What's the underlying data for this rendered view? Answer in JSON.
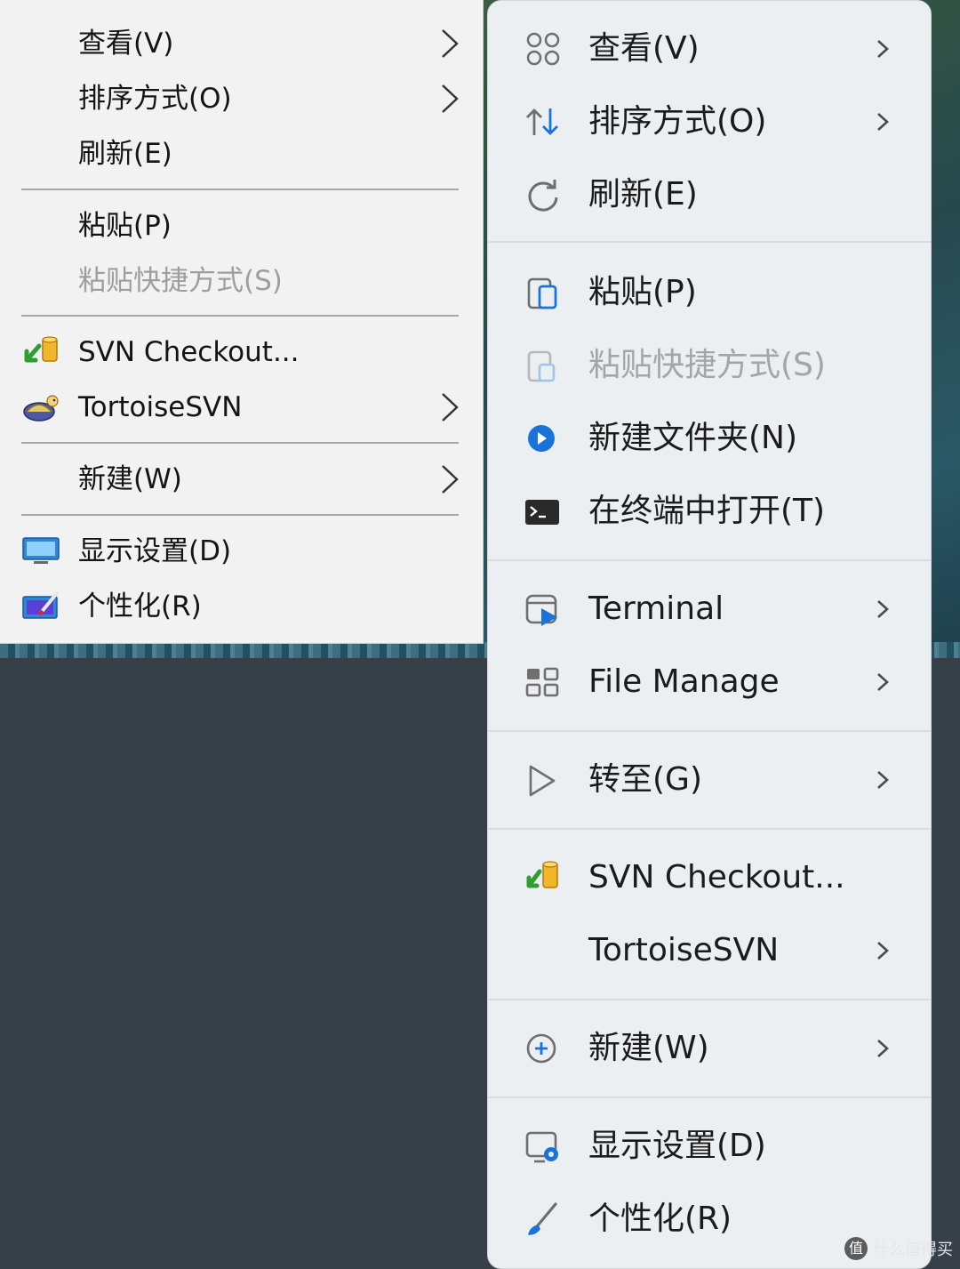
{
  "classic_menu": {
    "items": [
      {
        "label": "查看(V)",
        "icon": null,
        "submenu": true
      },
      {
        "label": "排序方式(O)",
        "icon": null,
        "submenu": true
      },
      {
        "label": "刷新(E)",
        "icon": null,
        "submenu": false
      },
      {
        "label": "粘贴(P)",
        "icon": null,
        "submenu": false
      },
      {
        "label": "粘贴快捷方式(S)",
        "icon": null,
        "submenu": false,
        "disabled": true
      },
      {
        "label": "SVN Checkout...",
        "icon": "svn-checkout-icon",
        "submenu": false
      },
      {
        "label": "TortoiseSVN",
        "icon": "tortoisesvn-icon",
        "submenu": true
      },
      {
        "label": "新建(W)",
        "icon": null,
        "submenu": true
      },
      {
        "label": "显示设置(D)",
        "icon": "monitor-icon",
        "submenu": false
      },
      {
        "label": "个性化(R)",
        "icon": "personalize-icon",
        "submenu": false
      }
    ]
  },
  "modern_menu": {
    "items": [
      {
        "label": "查看(V)",
        "icon": "view-grid-icon",
        "submenu": true
      },
      {
        "label": "排序方式(O)",
        "icon": "sort-arrows-icon",
        "submenu": true
      },
      {
        "label": "刷新(E)",
        "icon": "refresh-icon",
        "submenu": false
      },
      {
        "label": "粘贴(P)",
        "icon": "paste-icon",
        "submenu": false
      },
      {
        "label": "粘贴快捷方式(S)",
        "icon": "paste-shortcut-icon",
        "submenu": false,
        "disabled": true
      },
      {
        "label": "新建文件夹(N)",
        "icon": "new-folder-icon",
        "submenu": false
      },
      {
        "label": "在终端中打开(T)",
        "icon": "terminal-icon",
        "submenu": false
      },
      {
        "label": "Terminal",
        "icon": "terminal-app-icon",
        "submenu": true
      },
      {
        "label": "File Manage",
        "icon": "file-manage-icon",
        "submenu": true
      },
      {
        "label": "转至(G)",
        "icon": "goto-cursor-icon",
        "submenu": true
      },
      {
        "label": "SVN Checkout...",
        "icon": "svn-checkout-icon",
        "submenu": false
      },
      {
        "label": "TortoiseSVN",
        "icon": null,
        "submenu": true
      },
      {
        "label": "新建(W)",
        "icon": "new-plus-icon",
        "submenu": true
      },
      {
        "label": "显示设置(D)",
        "icon": "display-settings-icon",
        "submenu": false
      },
      {
        "label": "个性化(R)",
        "icon": "brush-icon",
        "submenu": false
      }
    ]
  },
  "watermark": {
    "text": "什么值得买",
    "logo": "值"
  },
  "colors": {
    "accent_blue": "#1a73d9",
    "menu10_bg": "#f2f2f2",
    "menu11_bg": "#eceff1",
    "desktop_bg": "#374049"
  }
}
